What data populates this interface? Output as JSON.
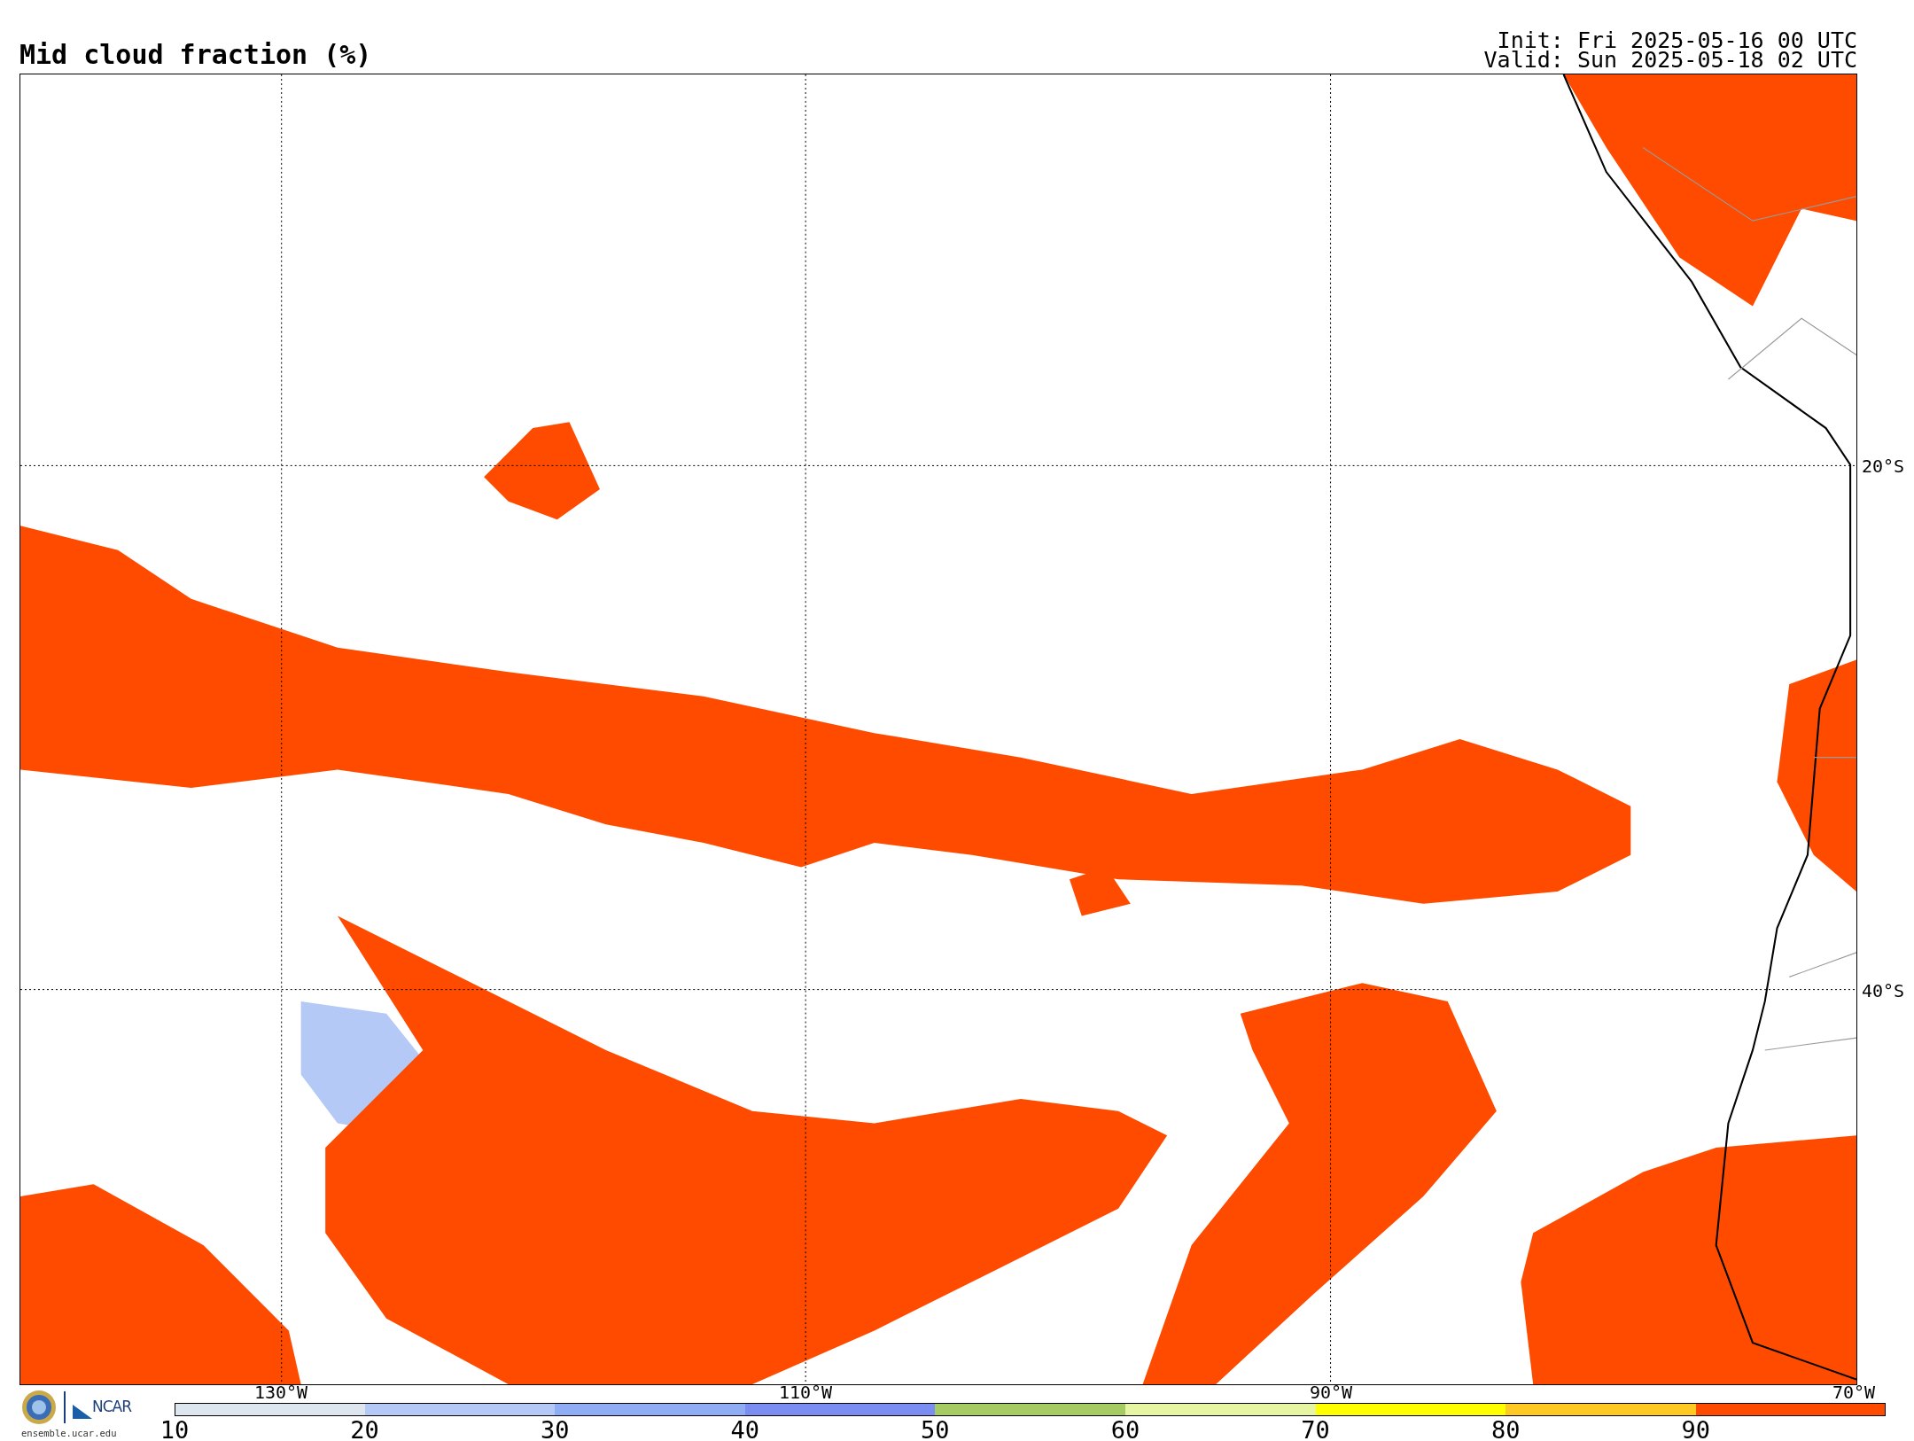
{
  "title": "Mid cloud fraction (%)",
  "init": "Init: Fri 2025-05-16 00 UTC",
  "valid": "Valid: Sun 2025-05-18 02 UTC",
  "map": {
    "longitude_labels": [
      "130°W",
      "110°W",
      "90°W",
      "70°W"
    ],
    "latitude_labels": [
      "20°S",
      "40°S"
    ]
  },
  "logos": {
    "ncar": "NCAR",
    "site": "ensemble.ucar.edu"
  },
  "colorbar": [
    {
      "label": "10",
      "color": "#dde6ee"
    },
    {
      "label": "20",
      "color": "#b5c9f7"
    },
    {
      "label": "30",
      "color": "#8eadf5"
    },
    {
      "label": "40",
      "color": "#7b8df0"
    },
    {
      "label": "50",
      "color": "#a5cc62"
    },
    {
      "label": "60",
      "color": "#e6f5a2"
    },
    {
      "label": "70",
      "color": "#ffff00"
    },
    {
      "label": "80",
      "color": "#fec922"
    },
    {
      "label": "90",
      "color": "#ff4b00"
    }
  ]
}
